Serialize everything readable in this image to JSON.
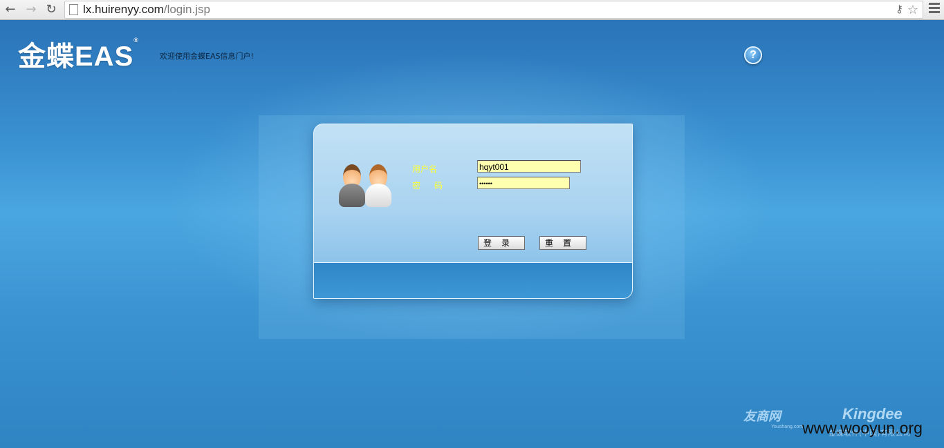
{
  "browser": {
    "url_host": "lx.huirenyy.com",
    "url_path": "/login.jsp",
    "back_glyph": "←",
    "forward_glyph": "→",
    "reload_glyph": "↻"
  },
  "header": {
    "logo": "金蝶EAS",
    "logo_mark": "®",
    "welcome": "欢迎使用金蝶EAS信息门户!",
    "help_glyph": "?"
  },
  "login": {
    "username_label": "用户名",
    "password_label": "密码",
    "username_value": "hqyt001",
    "password_value": "••••••",
    "login_button": "登录",
    "reset_button": "重置"
  },
  "footer": {
    "youshang": "友商网",
    "youshang_sub": "Youshang.com",
    "kingdee": "Kingdee",
    "company": "金蝶软件(中国)有限公司",
    "watermark": "www.wooyun.org"
  },
  "colors": {
    "background": "#2f86c8",
    "label_yellow": "#ffff33",
    "input_fill": "#ffffb0"
  }
}
